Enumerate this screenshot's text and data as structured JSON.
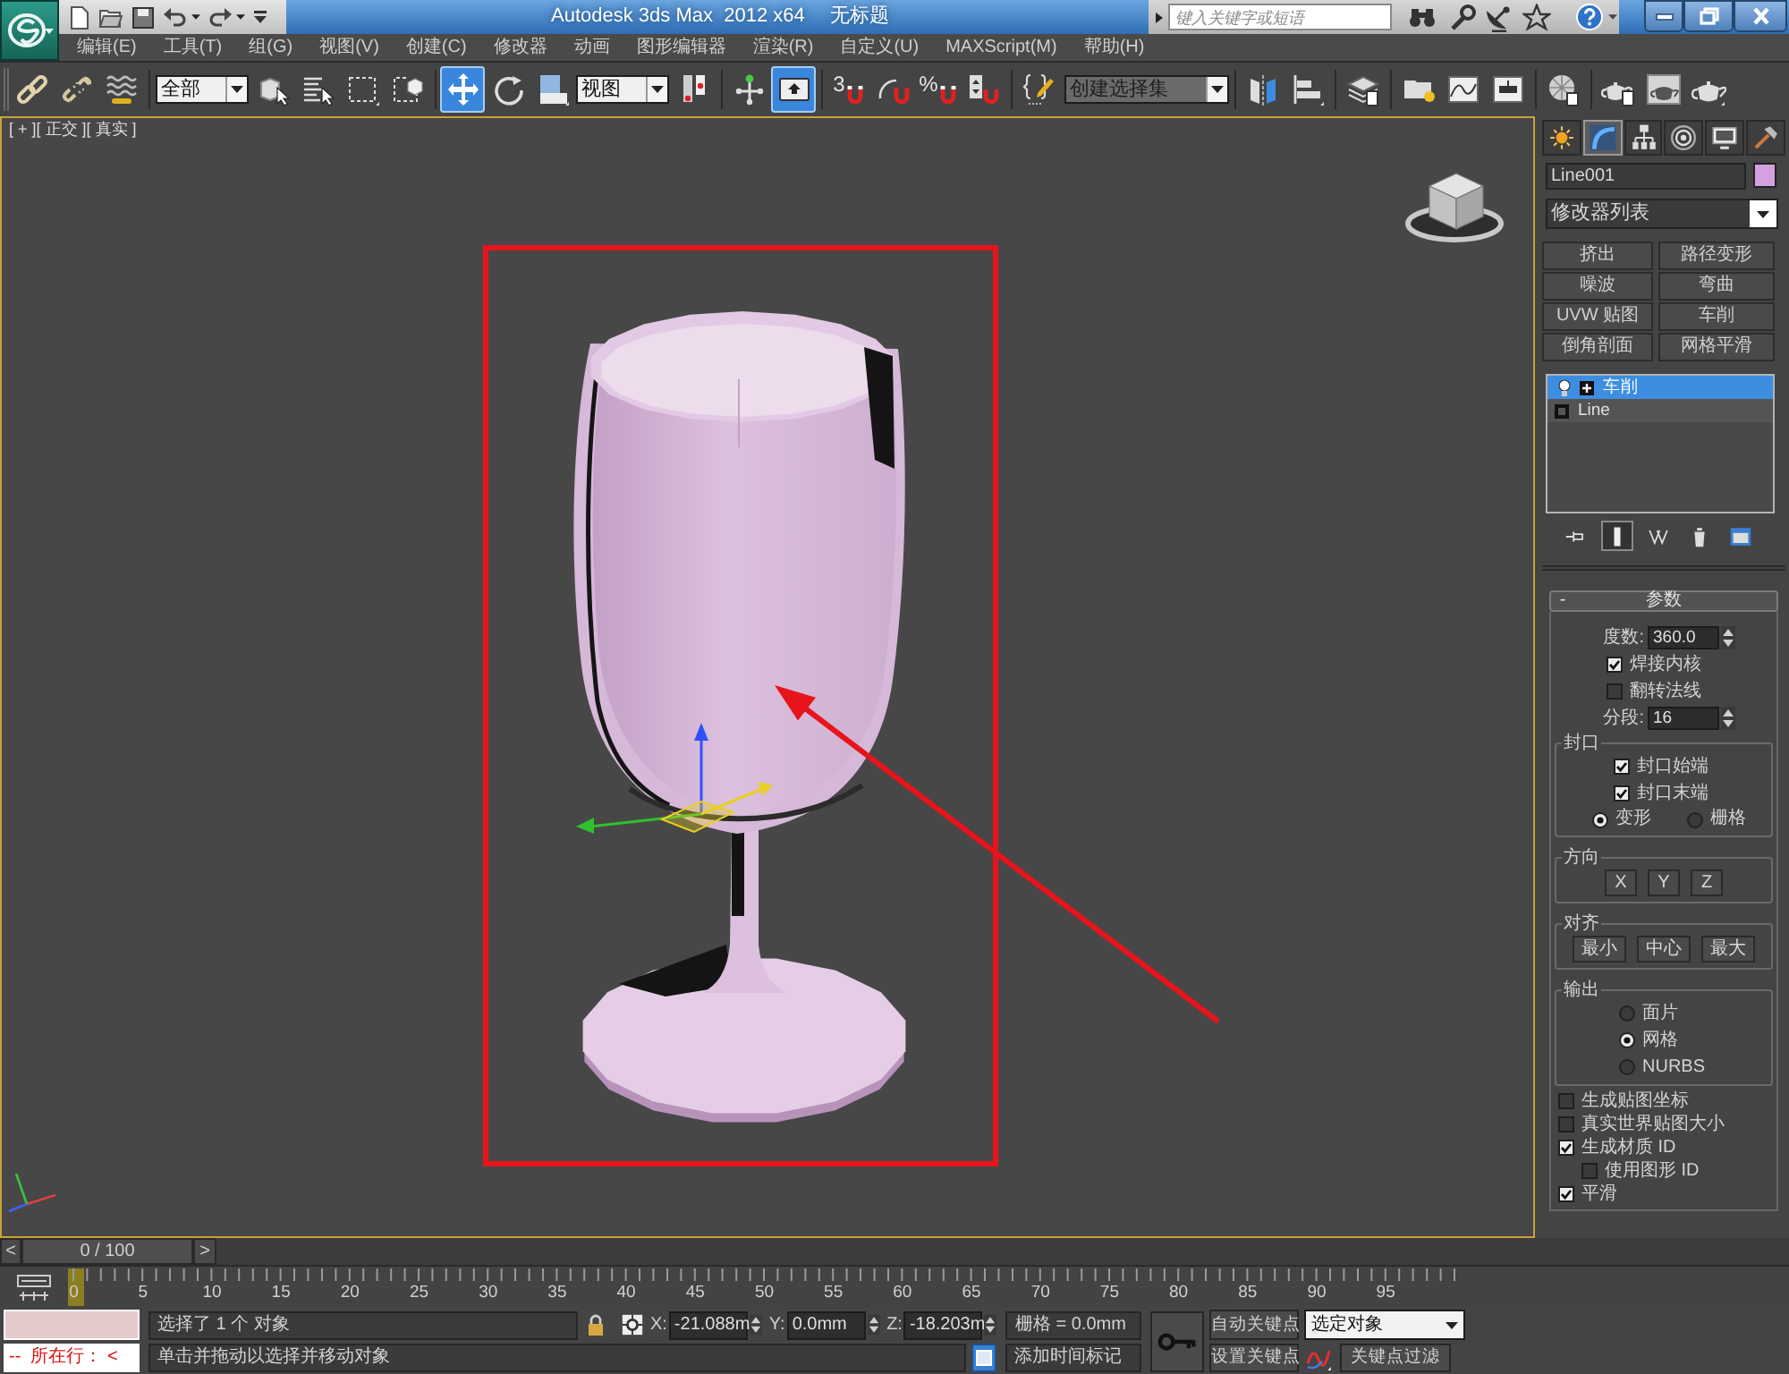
{
  "title_bar": {
    "title": "Autodesk 3ds Max  2012 x64",
    "document": "无标题",
    "search": {
      "placeholder": "键入关键字或短语"
    }
  },
  "menu_bar": [
    "编辑(E)",
    "工具(T)",
    "组(G)",
    "视图(V)",
    "创建(C)",
    "修改器",
    "动画",
    "图形编辑器",
    "渲染(R)",
    "自定义(U)",
    "MAXScript(M)",
    "帮助(H)"
  ],
  "main_toolbar": [
    {
      "kind": "link",
      "selected": false
    },
    {
      "kind": "unlink",
      "selected": false
    },
    {
      "kind": "bind",
      "selected": false
    },
    {
      "kind": "dropdown",
      "value": "全部"
    },
    {
      "kind": "select",
      "selected": false
    },
    {
      "kind": "selectname",
      "selected": false
    },
    {
      "kind": "region",
      "selected": false
    },
    {
      "kind": "crossing",
      "selected": false
    },
    {
      "kind": "move",
      "selected": true
    },
    {
      "kind": "rotate",
      "selected": false
    },
    {
      "kind": "scale",
      "selected": false
    },
    {
      "kind": "dropdown",
      "value": "视图"
    },
    {
      "kind": "pivot",
      "selected": false
    },
    {
      "kind": "manipulate",
      "selected": false
    },
    {
      "kind": "override",
      "selected": true
    },
    {
      "kind": "snap",
      "label": "3",
      "selected": false
    },
    {
      "kind": "anglesnap",
      "selected": false
    },
    {
      "kind": "percentsnap",
      "label": "%",
      "selected": false
    },
    {
      "kind": "spinnersnap",
      "selected": false
    },
    {
      "kind": "namedsets",
      "selected": false
    },
    {
      "kind": "combo",
      "value": "创建选择集"
    },
    {
      "kind": "mirror",
      "selected": false
    },
    {
      "kind": "align",
      "selected": false
    },
    {
      "kind": "layers",
      "selected": false
    },
    {
      "kind": "ribbon",
      "selected": false
    },
    {
      "kind": "curves",
      "selected": false
    },
    {
      "kind": "schematic",
      "selected": false
    },
    {
      "kind": "material",
      "selected": false
    },
    {
      "kind": "rendersetup",
      "selected": false
    },
    {
      "kind": "framewindow",
      "selected": false
    },
    {
      "kind": "render",
      "selected": false
    }
  ],
  "viewport": {
    "label": "[ + ][ 正交 ][ 真实 ]"
  },
  "command_panel": {
    "tabs": [
      {
        "kind": "create",
        "selected": false
      },
      {
        "kind": "modify",
        "selected": true
      },
      {
        "kind": "hierarchy",
        "selected": false
      },
      {
        "kind": "motion",
        "selected": false
      },
      {
        "kind": "display",
        "selected": false
      },
      {
        "kind": "utilities",
        "selected": false
      }
    ],
    "object": {
      "name": "Line001",
      "color": "#d69fe2"
    },
    "modifier_list": "修改器列表",
    "modifier_buttons": [
      "挤出",
      "路径变形",
      "噪波",
      "弯曲",
      "UVW 贴图",
      "车削",
      "倒角剖面",
      "网格平滑"
    ],
    "stack": [
      {
        "label": "车削",
        "kind": "modifier",
        "selected": true
      },
      {
        "label": "Line",
        "kind": "base",
        "selected": false
      }
    ],
    "stack_tools": [
      {
        "kind": "pin",
        "selected": false
      },
      {
        "kind": "endresult",
        "selected": true
      },
      {
        "kind": "unique",
        "selected": false
      },
      {
        "kind": "remove",
        "selected": false
      },
      {
        "kind": "configure",
        "selected": false
      }
    ],
    "rollout": {
      "toggle": "-",
      "title": "参数",
      "controls": [
        {
          "kind": "spinner",
          "label": "度数:",
          "value": "360.0"
        },
        {
          "kind": "checkbox",
          "label": "焊接内核",
          "checked": true
        },
        {
          "kind": "checkbox",
          "label": "翻转法线",
          "checked": false
        },
        {
          "kind": "spinner",
          "label": "分段:",
          "value": "16"
        }
      ],
      "groups": [
        {
          "title": "封口",
          "controls": [
            {
              "kind": "checkbox",
              "label": "封口始端",
              "checked": true
            },
            {
              "kind": "checkbox",
              "label": "封口末端",
              "checked": true
            },
            {
              "kind": "radios",
              "options": [
                {
                  "label": "变形",
                  "selected": true
                },
                {
                  "label": "栅格",
                  "selected": false
                }
              ]
            }
          ]
        },
        {
          "title": "方向",
          "controls": [
            {
              "kind": "buttons",
              "labels": [
                "X",
                "Y",
                "Z"
              ]
            }
          ]
        },
        {
          "title": "对齐",
          "controls": [
            {
              "kind": "buttons",
              "labels": [
                "最小",
                "中心",
                "最大"
              ]
            }
          ]
        },
        {
          "title": "输出",
          "controls": [
            {
              "kind": "radiolist",
              "options": [
                {
                  "label": "面片",
                  "selected": false
                },
                {
                  "label": "网格",
                  "selected": true
                },
                {
                  "label": "NURBS",
                  "selected": false
                }
              ]
            }
          ]
        }
      ],
      "options": [
        {
          "label": "生成贴图坐标",
          "checked": false
        },
        {
          "label": "真实世界贴图大小",
          "checked": false
        },
        {
          "label": "生成材质 ID",
          "checked": true,
          "children": [
            {
              "label": "使用图形 ID",
              "checked": false
            }
          ]
        },
        {
          "label": "平滑",
          "checked": true
        }
      ]
    }
  },
  "time_slider": {
    "previous": "<",
    "position": "0 / 100",
    "next": ">"
  },
  "track_bar": {
    "ticks": [
      "0",
      "5",
      "10",
      "15",
      "20",
      "25",
      "30",
      "35",
      "40",
      "45",
      "50",
      "55",
      "60",
      "65",
      "70",
      "75",
      "80",
      "85",
      "90",
      "95"
    ]
  },
  "status_bar": {
    "listener_line": "--  所在行： <",
    "prompt": "选择了 1 个 对象",
    "hint": "单击并拖动以选择并移动对象",
    "coords": [
      {
        "axis": "X:",
        "value": "-21.088m"
      },
      {
        "axis": "Y:",
        "value": "0.0mm"
      },
      {
        "axis": "Z:",
        "value": "-18.203m"
      }
    ],
    "grid": "栅格 = 0.0mm",
    "time_tag": "添加时间标记",
    "auto_key": "自动关键点",
    "key_mode": "选定对象",
    "set_key": "设置关键点",
    "key_filters": "关键点过滤"
  }
}
